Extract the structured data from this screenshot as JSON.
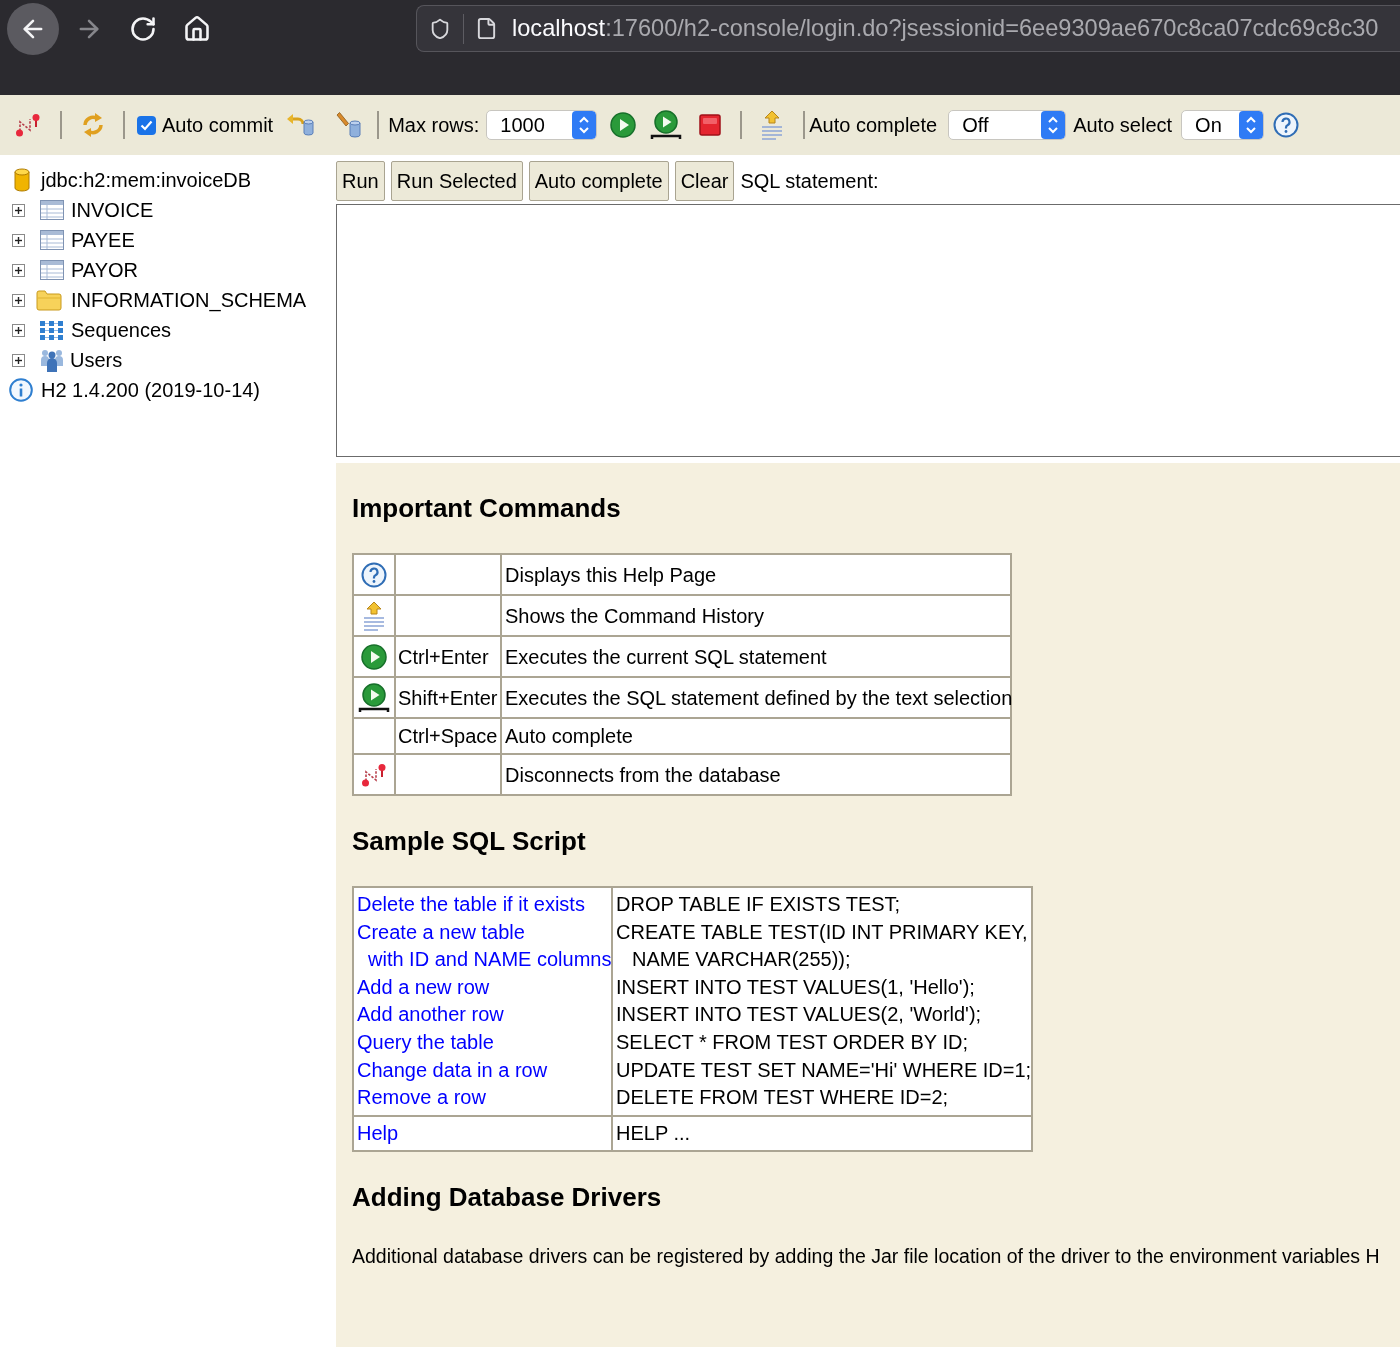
{
  "browser": {
    "nav": [
      {
        "kind": "back",
        "disabled": false
      },
      {
        "kind": "forward",
        "disabled": true
      },
      {
        "kind": "reload",
        "disabled": false
      },
      {
        "kind": "home",
        "disabled": false
      }
    ],
    "address": {
      "host": "localhost",
      "rest": ":17600/h2-console/login.do?jsessionid=6ee9309ae670c8ca07cdc69c8c30"
    }
  },
  "toolbar": {
    "auto_commit": {
      "label": "Auto commit",
      "checked": true
    },
    "max_rows": {
      "label": "Max rows:",
      "value": "1000"
    },
    "auto_complete": {
      "label": "Auto complete",
      "value": "Off"
    },
    "auto_select": {
      "label": "Auto select",
      "value": "On"
    }
  },
  "tree": [
    {
      "kind": "database",
      "label": "jdbc:h2:mem:invoiceDB"
    },
    {
      "kind": "table",
      "label": "INVOICE",
      "expanded": false
    },
    {
      "kind": "table",
      "label": "PAYEE",
      "expanded": false
    },
    {
      "kind": "table",
      "label": "PAYOR",
      "expanded": false
    },
    {
      "kind": "folder",
      "label": "INFORMATION_SCHEMA",
      "expanded": false
    },
    {
      "kind": "sequences",
      "label": "Sequences",
      "expanded": false
    },
    {
      "kind": "users",
      "label": "Users",
      "expanded": false
    },
    {
      "kind": "info",
      "label": "H2 1.4.200 (2019-10-14)"
    }
  ],
  "query": {
    "buttons": [
      "Run",
      "Run Selected",
      "Auto complete",
      "Clear"
    ],
    "label": "SQL statement:"
  },
  "important_commands": {
    "title": "Important Commands",
    "rows": [
      {
        "kind": "help",
        "description": "Displays this Help Page"
      },
      {
        "kind": "history",
        "description": "Shows the Command History"
      },
      {
        "kind": "run",
        "keys": "Ctrl+Enter",
        "description": "Executes the current SQL statement"
      },
      {
        "kind": "run_selected",
        "keys": "Shift+Enter",
        "description": "Executes the SQL statement defined by the text selection"
      },
      {
        "kind": "plain",
        "keys": "Ctrl+Space",
        "description": "Auto complete"
      },
      {
        "kind": "disconnect",
        "description": "Disconnects from the database"
      }
    ]
  },
  "sample_sql_script": {
    "title": "Sample SQL Script",
    "groups": [
      {
        "steps": [
          {
            "link_lines": [
              "Delete the table if it exists"
            ],
            "sql_lines": [
              "DROP TABLE IF EXISTS TEST;"
            ]
          },
          {
            "link_lines": [
              "Create a new table",
              "with ID and NAME columns"
            ],
            "sql_lines": [
              "CREATE TABLE TEST(ID INT PRIMARY KEY,",
              "NAME VARCHAR(255));"
            ]
          },
          {
            "link_lines": [
              "Add a new row"
            ],
            "sql_lines": [
              "INSERT INTO TEST VALUES(1, 'Hello');"
            ]
          },
          {
            "link_lines": [
              "Add another row"
            ],
            "sql_lines": [
              "INSERT INTO TEST VALUES(2, 'World');"
            ]
          },
          {
            "link_lines": [
              "Query the table"
            ],
            "sql_lines": [
              "SELECT * FROM TEST ORDER BY ID;"
            ]
          },
          {
            "link_lines": [
              "Change data in a row"
            ],
            "sql_lines": [
              "UPDATE TEST SET NAME='Hi' WHERE ID=1;"
            ]
          },
          {
            "link_lines": [
              "Remove a row"
            ],
            "sql_lines": [
              "DELETE FROM TEST WHERE ID=2;"
            ]
          }
        ]
      },
      {
        "steps": [
          {
            "link_lines": [
              "Help"
            ],
            "sql_lines": [
              "HELP ..."
            ]
          }
        ]
      }
    ]
  },
  "adding_database_drivers": {
    "title": "Adding Database Drivers",
    "text": "Additional database drivers can be registered by adding the Jar file location of the driver to the environment variables H"
  }
}
